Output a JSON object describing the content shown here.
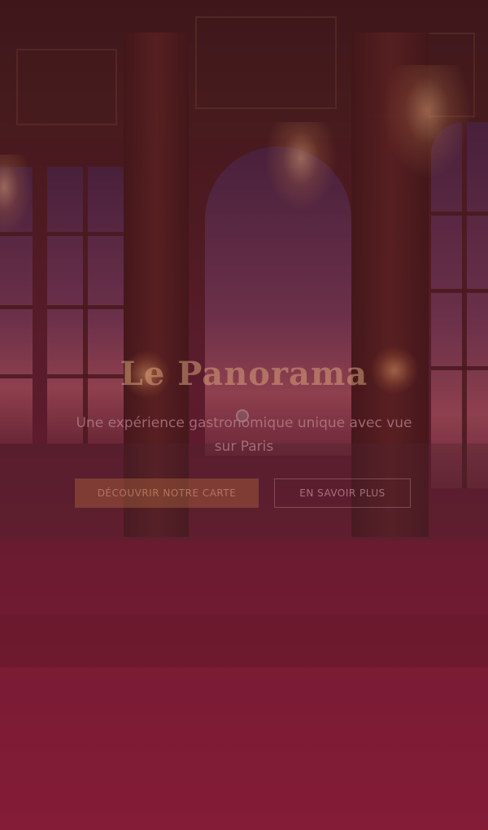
{
  "hero": {
    "title": "Le Panorama",
    "subtitle": "Une expérience gastronomique unique avec vue sur Paris",
    "primary_button": "DÉCOUVRIR NOTRE CARTE",
    "secondary_button": "EN SAVOIR PLUS"
  },
  "colors": {
    "overlay": "#7f2038",
    "accent": "#a8623e"
  }
}
